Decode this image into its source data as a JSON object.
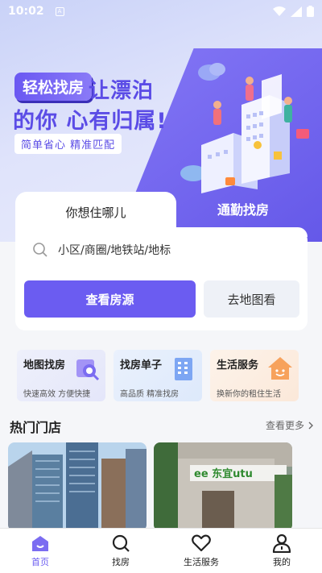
{
  "status_bar": {
    "time": "10:02",
    "app_badge": "A"
  },
  "hero": {
    "tag": "轻松找房",
    "line1": "让漂泊",
    "line2": "的你 心有归属!",
    "subtitle": "简单省心 精准匹配"
  },
  "search": {
    "tab_left": "你想住哪儿",
    "tab_right": "通勤找房",
    "placeholder": "小区/商圈/地铁站/地标",
    "primary_button": "查看房源",
    "secondary_button": "去地图看"
  },
  "features": [
    {
      "title": "地图找房",
      "subtitle": "快速高效 方便快捷",
      "icon": "map-search-icon"
    },
    {
      "title": "找房单子",
      "subtitle": "高品质 精准找房",
      "icon": "building-list-icon"
    },
    {
      "title": "生活服务",
      "subtitle": "换新你的租住生活",
      "icon": "house-smile-icon"
    }
  ],
  "hot_stores": {
    "title": "热门门店",
    "more": "查看更多",
    "stores": [
      {
        "name": "apartment-towers-photo"
      },
      {
        "name": "storefront-photo",
        "sign": "ee 东宜utu"
      }
    ]
  },
  "tabbar": [
    {
      "label": "首页",
      "icon": "home-icon",
      "active": true
    },
    {
      "label": "找房",
      "icon": "search-icon",
      "active": false
    },
    {
      "label": "生活服务",
      "icon": "heart-icon",
      "active": false
    },
    {
      "label": "我的",
      "icon": "user-icon",
      "active": false
    }
  ],
  "colors": {
    "accent": "#6b5cf1",
    "background": "#f5f6f9"
  }
}
